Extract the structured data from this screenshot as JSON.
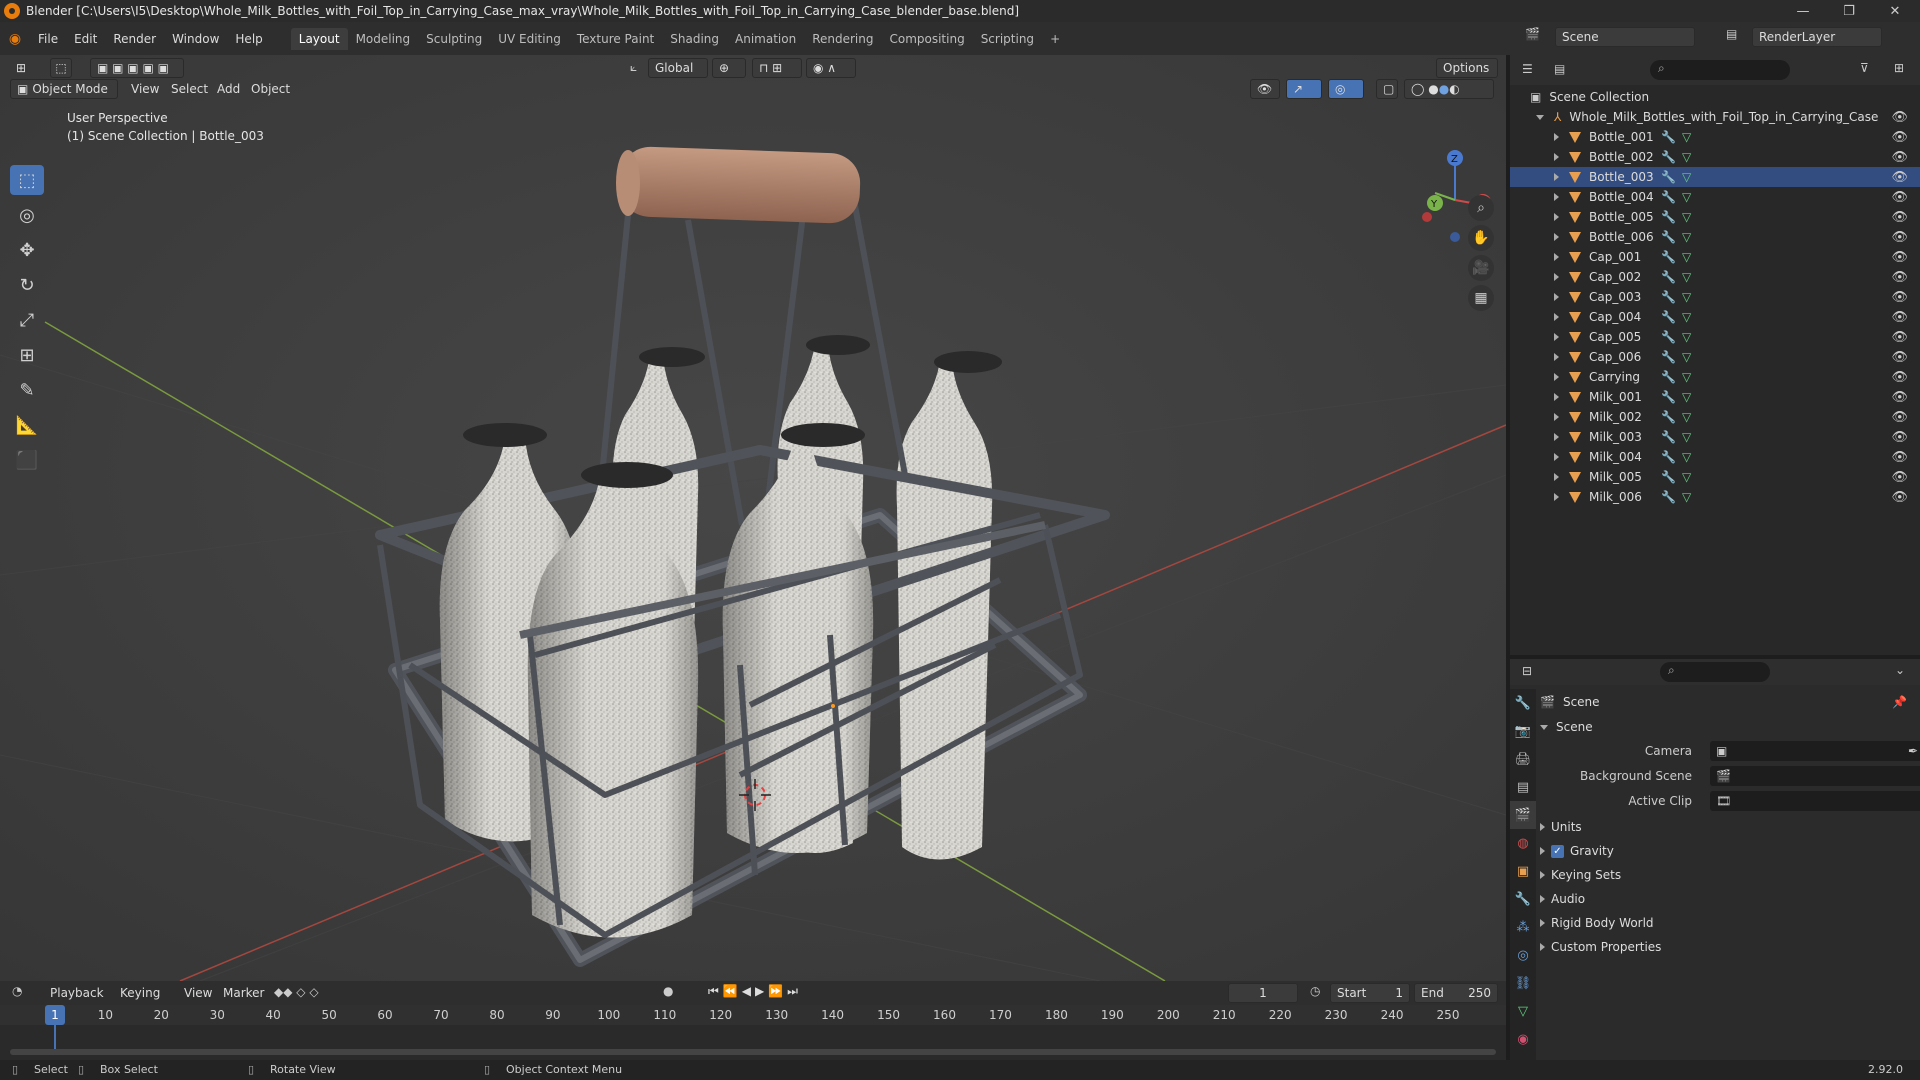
{
  "window": {
    "title": "Blender [C:\\Users\\I5\\Desktop\\Whole_Milk_Bottles_with_Foil_Top_in_Carrying_Case_max_vray\\Whole_Milk_Bottles_with_Foil_Top_in_Carrying_Case_blender_base.blend]",
    "minimize": "—",
    "maximize": "❐",
    "close": "✕"
  },
  "menu": [
    "File",
    "Edit",
    "Render",
    "Window",
    "Help"
  ],
  "workspaces": [
    "Layout",
    "Modeling",
    "Sculpting",
    "UV Editing",
    "Texture Paint",
    "Shading",
    "Animation",
    "Rendering",
    "Compositing",
    "Scripting"
  ],
  "workspace_add": "+",
  "scene_selector": {
    "value": "Scene"
  },
  "renderlayer_selector": {
    "value": "RenderLayer"
  },
  "viewport": {
    "transform_orientation": "Global",
    "options": "Options",
    "mode": "Object Mode",
    "menus": [
      "View",
      "Select",
      "Add",
      "Object"
    ],
    "overlay_title": "User Perspective",
    "overlay_subtitle": "(1) Scene Collection | Bottle_003",
    "gizmo_axes": {
      "x": "X",
      "y": "Y",
      "z": "Z"
    }
  },
  "outliner": {
    "root": "Scene Collection",
    "collection": "Whole_Milk_Bottles_with_Foil_Top_in_Carrying_Case",
    "selected": "Bottle_003",
    "items": [
      "Bottle_001",
      "Bottle_002",
      "Bottle_003",
      "Bottle_004",
      "Bottle_005",
      "Bottle_006",
      "Cap_001",
      "Cap_002",
      "Cap_003",
      "Cap_004",
      "Cap_005",
      "Cap_006",
      "Carrying",
      "Milk_001",
      "Milk_002",
      "Milk_003",
      "Milk_004",
      "Milk_005",
      "Milk_006"
    ]
  },
  "properties": {
    "context": "Scene",
    "panel": "Scene",
    "fields": [
      {
        "label": "Camera"
      },
      {
        "label": "Background Scene"
      },
      {
        "label": "Active Clip"
      }
    ],
    "subpanels": [
      "Units",
      "Gravity",
      "Keying Sets",
      "Audio",
      "Rigid Body World",
      "Custom Properties"
    ],
    "gravity_checked": true
  },
  "timeline": {
    "menus": [
      "Playback",
      "Keying",
      "View",
      "Marker"
    ],
    "current_frame": "1",
    "start_label": "Start",
    "start": "1",
    "end_label": "End",
    "end": "250",
    "ticks": [
      "1",
      "10",
      "20",
      "30",
      "40",
      "50",
      "60",
      "70",
      "80",
      "90",
      "100",
      "110",
      "120",
      "130",
      "140",
      "150",
      "160",
      "170",
      "180",
      "190",
      "200",
      "210",
      "220",
      "230",
      "240",
      "250"
    ]
  },
  "status": {
    "select": "Select",
    "box_select": "Box Select",
    "rotate_view": "Rotate View",
    "context_menu": "Object Context Menu",
    "version": "2.92.0"
  }
}
